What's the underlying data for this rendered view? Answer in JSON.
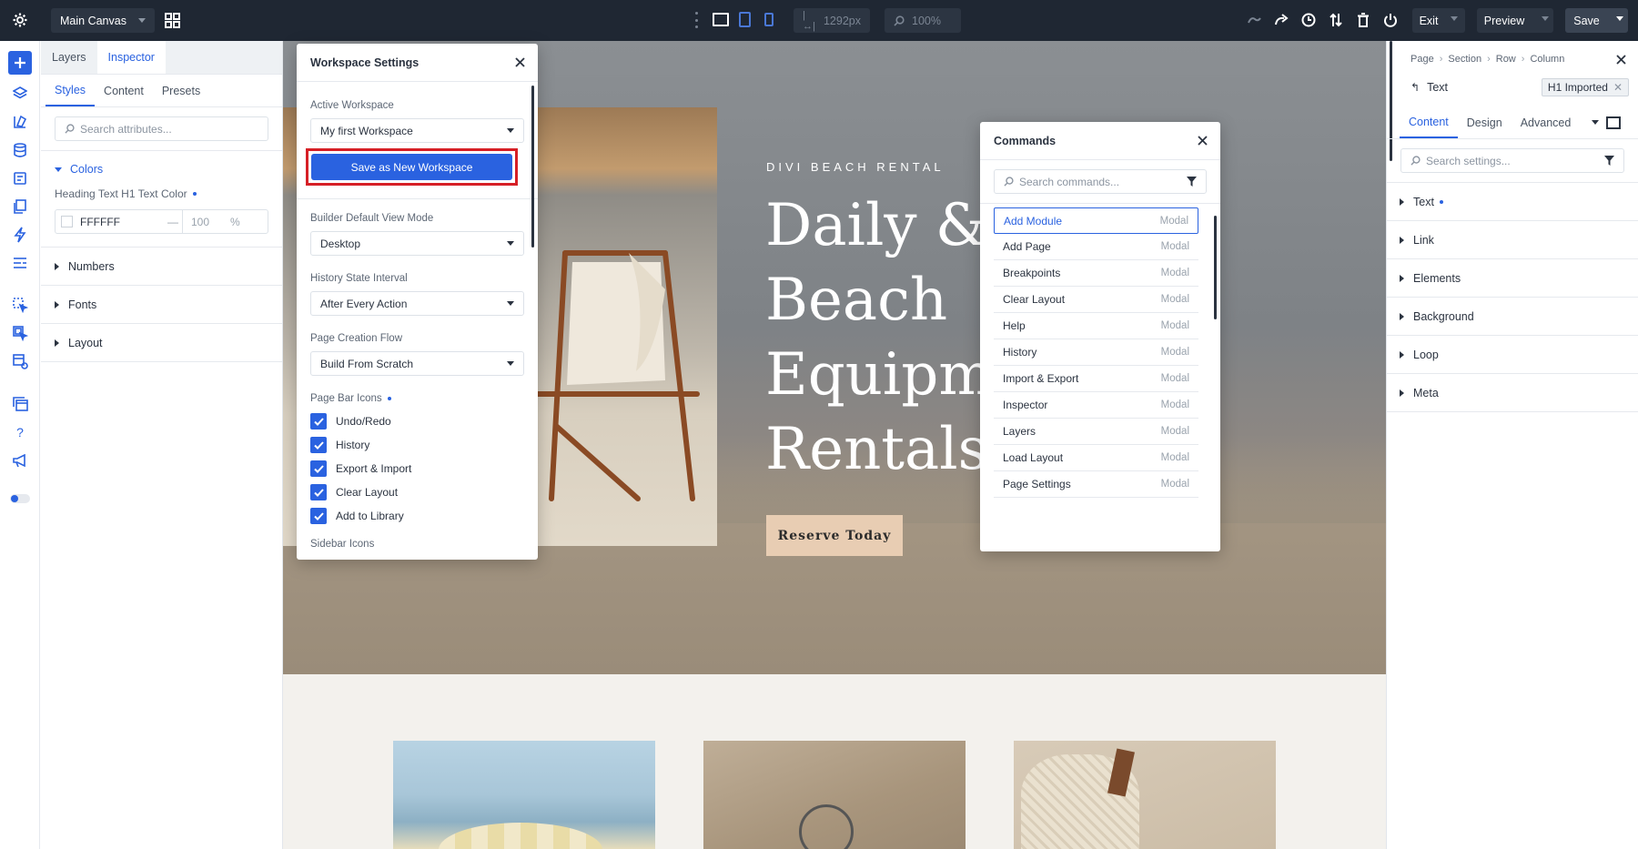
{
  "topbar": {
    "canvas_select": "Main Canvas",
    "width_value": "1292px",
    "zoom_value": "100%",
    "exit_label": "Exit",
    "preview_label": "Preview",
    "save_label": "Save"
  },
  "left_panel": {
    "tabs": [
      "Layers",
      "Inspector"
    ],
    "subtabs": [
      "Styles",
      "Content",
      "Presets"
    ],
    "search_placeholder": "Search attributes...",
    "colors_section": "Colors",
    "color_field_label": "Heading Text H1 Text Color",
    "color_hex": "FFFFFF",
    "color_dash": "—",
    "color_opacity": "100",
    "color_unit": "%",
    "sections": [
      "Numbers",
      "Fonts",
      "Layout"
    ]
  },
  "workspace_modal": {
    "title": "Workspace Settings",
    "active_workspace_label": "Active Workspace",
    "active_workspace_value": "My first Workspace",
    "save_button": "Save as New Workspace",
    "view_mode_label": "Builder Default View Mode",
    "view_mode_value": "Desktop",
    "history_label": "History State Interval",
    "history_value": "After Every Action",
    "page_flow_label": "Page Creation Flow",
    "page_flow_value": "Build From Scratch",
    "page_bar_label": "Page Bar Icons",
    "page_bar_items": [
      "Undo/Redo",
      "History",
      "Export & Import",
      "Clear Layout",
      "Add to Library"
    ],
    "sidebar_icons_label": "Sidebar Icons"
  },
  "hero": {
    "kicker": "DIVI BEACH RENTAL",
    "heading_lines": [
      "Daily &",
      "Beach",
      "Equipm",
      "Rentals"
    ],
    "cta": "Reserve Today"
  },
  "commands_modal": {
    "title": "Commands",
    "search_placeholder": "Search commands...",
    "items": [
      {
        "label": "Add Module",
        "tag": "Modal"
      },
      {
        "label": "Add Page",
        "tag": "Modal"
      },
      {
        "label": "Breakpoints",
        "tag": "Modal"
      },
      {
        "label": "Clear Layout",
        "tag": "Modal"
      },
      {
        "label": "Help",
        "tag": "Modal"
      },
      {
        "label": "History",
        "tag": "Modal"
      },
      {
        "label": "Import & Export",
        "tag": "Modal"
      },
      {
        "label": "Inspector",
        "tag": "Modal"
      },
      {
        "label": "Layers",
        "tag": "Modal"
      },
      {
        "label": "Load Layout",
        "tag": "Modal"
      },
      {
        "label": "Page Settings",
        "tag": "Modal"
      }
    ]
  },
  "right_panel": {
    "breadcrumb": [
      "Page",
      "Section",
      "Row",
      "Column"
    ],
    "module_name": "Text",
    "preset_badge": "H1 Imported",
    "tabs": [
      "Content",
      "Design",
      "Advanced"
    ],
    "search_placeholder": "Search settings...",
    "sections": [
      "Text",
      "Link",
      "Elements",
      "Background",
      "Loop",
      "Meta"
    ]
  },
  "colors": {
    "accent": "#2a62e0",
    "topbar_bg": "#1f2733",
    "highlight_red": "#d61f26",
    "cta_bg": "#e8cdb3"
  }
}
